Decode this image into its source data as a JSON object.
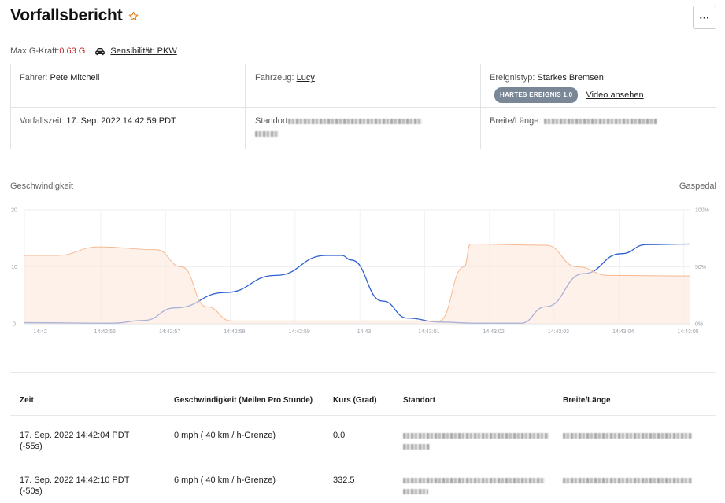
{
  "header": {
    "title": "Vorfallsbericht",
    "more_label": "···"
  },
  "meta": {
    "g_label": "Max G-Kraft:",
    "g_value": "0.63 G",
    "sensitivity": "Sensibilität: PKW"
  },
  "info": {
    "driver_label": "Fahrer:",
    "driver_value": "Pete Mitchell",
    "vehicle_label": "Fahrzeug:",
    "vehicle_value": "Lucy",
    "event_type_label": "Ereignistyp:",
    "event_type_value": "Starkes Bremsen",
    "badge": "HARTES EREIGNIS 1.0",
    "video_link": "Video ansehen",
    "time_label": "Vorfallszeit:",
    "time_value": "17. Sep. 2022 14:42:59 PDT",
    "location_label": "Standort",
    "latlng_label": "Breite/Länge:"
  },
  "chart_data": {
    "type": "line",
    "left_axis_title": "Geschwindigkeit",
    "right_axis_title": "Gaspedal",
    "left_ticks": [
      "20",
      "10",
      "0"
    ],
    "right_ticks": [
      "100%",
      "50%",
      "0%"
    ],
    "ylim_left": [
      0,
      20
    ],
    "ylim_right": [
      0,
      100
    ],
    "x_ticks": [
      "14:42",
      "14:42:56",
      "14:42:57",
      "14:42:58",
      "14:42:59",
      "14:43",
      "14:43:01",
      "14:43:02",
      "14:43:03",
      "14:43:04",
      "14:43:05"
    ],
    "marker_x": "14:43",
    "grid": true,
    "series": [
      {
        "color": "#2d5fd0",
        "axis": "left",
        "points": [
          [
            0,
            0.2
          ],
          [
            1.4,
            0.1
          ],
          [
            1.9,
            0.6
          ],
          [
            2.4,
            2.8
          ],
          [
            3.2,
            5.5
          ],
          [
            4.0,
            8.5
          ],
          [
            4.8,
            12
          ],
          [
            5.05,
            12
          ],
          [
            5.2,
            11.2
          ],
          [
            5.7,
            4
          ],
          [
            6.1,
            1
          ],
          [
            6.6,
            0.3
          ],
          [
            7.2,
            0.1
          ],
          [
            7.9,
            0.1
          ],
          [
            8.3,
            3
          ],
          [
            8.9,
            8.8
          ],
          [
            9.5,
            12.3
          ],
          [
            9.9,
            13.9
          ],
          [
            10.6,
            14
          ]
        ]
      },
      {
        "color": "#f5b890",
        "axis": "right",
        "area": true,
        "points": [
          [
            0,
            12
          ],
          [
            0.5,
            12
          ],
          [
            1.2,
            13.5
          ],
          [
            2.1,
            13
          ],
          [
            2.5,
            10
          ],
          [
            2.9,
            3
          ],
          [
            3.3,
            0.5
          ],
          [
            6.6,
            0.5
          ],
          [
            7.0,
            10
          ],
          [
            7.1,
            14
          ],
          [
            8.3,
            13.8
          ],
          [
            8.8,
            10
          ],
          [
            9.3,
            8.5
          ],
          [
            10.6,
            8.4
          ]
        ]
      }
    ]
  },
  "table": {
    "headers": [
      "Zeit",
      "Geschwindigkeit (Meilen Pro Stunde)",
      "Kurs (Grad)",
      "Standort",
      "Breite/Länge"
    ],
    "rows": [
      {
        "time": "17. Sep. 2022 14:42:04 PDT",
        "rel": "(-55s)",
        "speed": "0 mph ( 40 km / h-Grenze)",
        "course": "0.0"
      },
      {
        "time": "17. Sep. 2022 14:42:10 PDT",
        "rel": "(-50s)",
        "speed": "6 mph ( 40 km / h-Grenze)",
        "course": "332.5"
      }
    ]
  }
}
